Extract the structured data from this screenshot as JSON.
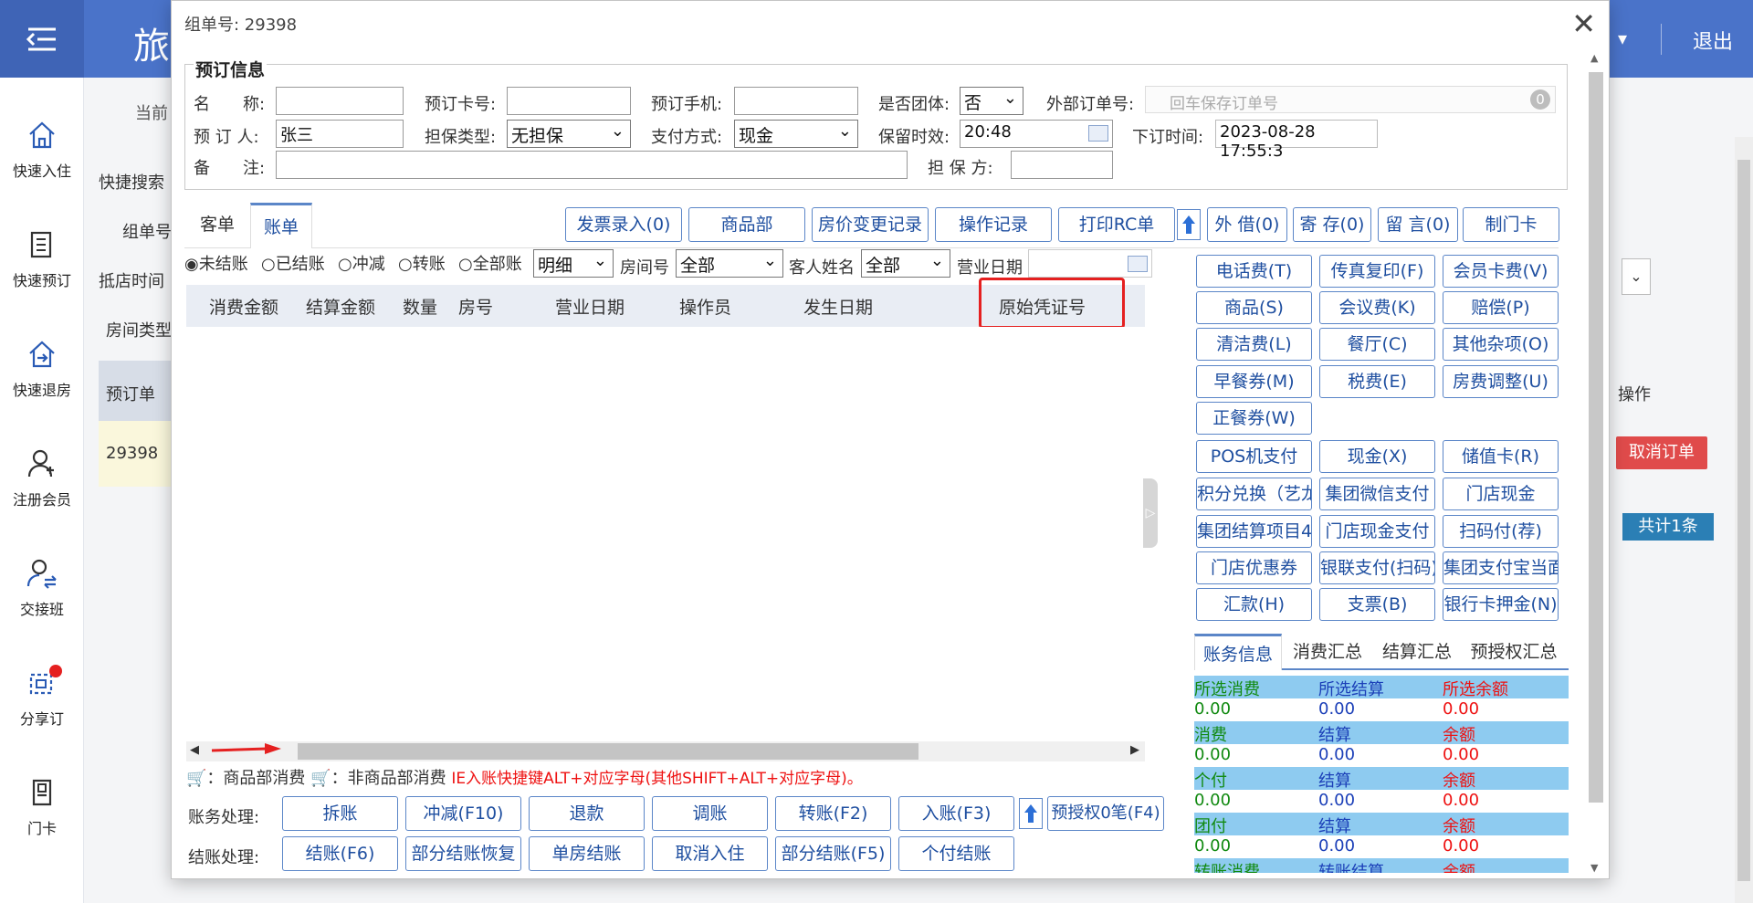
{
  "app": {
    "title_fragment": "旅",
    "logout": "退出",
    "sidebar": [
      "快速入住",
      "快速预订",
      "快速退房",
      "注册会员",
      "交接班",
      "分享订",
      "门卡"
    ]
  },
  "background": {
    "current_fragment": "当前",
    "quick_search": "快捷搜索",
    "group_no_label": "组单号",
    "arrival_label": "抵店时间",
    "room_type_label": "房间类型",
    "col_order": "预订单",
    "col_action_fragment": "操作",
    "row_order": "29398",
    "cancel_button": "取消订单",
    "total": "共计1条"
  },
  "modal": {
    "title": "组单号: 29398",
    "close": "✕",
    "booking": {
      "legend": "预订信息",
      "name_label": "名　　称:",
      "name_value": "",
      "card_label": "预订卡号:",
      "card_value": "",
      "phone_label": "预订手机:",
      "phone_value": "",
      "group_label": "是否团体:",
      "group_value": "否",
      "ext_order_label": "外部订单号:",
      "ext_order_placeholder": "回车保存订单号",
      "ext_order_badge": "0",
      "booker_label": "预 订 人:",
      "booker_value": "张三",
      "guarantee_type_label": "担保类型:",
      "guarantee_type_value": "无担保",
      "payment_label": "支付方式:",
      "payment_value": "现金",
      "hold_label": "保留时效:",
      "hold_value": "20:48",
      "order_time_label": "下订时间:",
      "order_time_value": "2023-08-28 17:55:3",
      "remark_label": "备　　注:",
      "remark_value": "",
      "guarantor_label": "担 保 方:",
      "guarantor_value": ""
    },
    "tabs": [
      "客单",
      "账单"
    ],
    "toolbar": [
      "发票录入(0)",
      "商品部",
      "房价变更记录",
      "操作记录",
      "打印RC单",
      "外 借(0)",
      "寄 存(0)",
      "留 言(0)",
      "制门卡"
    ],
    "filters": {
      "radios": [
        "未结账",
        "已结账",
        "冲减",
        "转账",
        "全部账"
      ],
      "detail_value": "明细",
      "room_label": "房间号",
      "room_value": "全部",
      "guest_label": "客人姓名",
      "guest_value": "全部",
      "bizdate_label": "营业日期"
    },
    "grid_columns": [
      "消费金额",
      "结算金额",
      "数量",
      "房号",
      "营业日期",
      "操作员",
      "发生日期",
      "原始凭证号"
    ],
    "charge_buttons": [
      "电话费(T)",
      "传真复印(F)",
      "会员卡费(V)",
      "商品(S)",
      "会议费(K)",
      "赔偿(P)",
      "清洁费(L)",
      "餐厅(C)",
      "其他杂项(O)",
      "早餐券(M)",
      "税费(E)",
      "房费调整(U)",
      "正餐券(W)"
    ],
    "payment_buttons": [
      "POS机支付",
      "现金(X)",
      "储值卡(R)",
      "积分兑换（艺龙）",
      "集团微信支付",
      "门店现金",
      "集团结算项目4",
      "门店现金支付",
      "扫码付(荐)",
      "门店优惠券",
      "银联支付(扫码)",
      "集团支付宝当面付",
      "汇款(H)",
      "支票(B)",
      "银行卡押金(N)"
    ],
    "help": {
      "goods": "：商品部消费",
      "non_goods": "：非商品部消费",
      "hint": "IE入账快捷键ALT+对应字母(其他SHIFT+ALT+对应字母)。"
    },
    "account_label": "账务处理:",
    "account_buttons": [
      "拆账",
      "冲减(F10)",
      "退款",
      "调账",
      "转账(F2)",
      "入账(F3)",
      "预授权0笔(F4)"
    ],
    "checkout_label": "结账处理:",
    "checkout_buttons": [
      "结账(F6)",
      "部分结账恢复",
      "单房结账",
      "取消入住",
      "部分结账(F5)",
      "个付结账"
    ],
    "summary_tabs": [
      "账务信息",
      "消费汇总",
      "结算汇总",
      "预授权汇总"
    ],
    "summary_rows": [
      {
        "a": "所选消费",
        "b": "所选结算",
        "c": "所选余额",
        "header": true
      },
      {
        "a": "0.00",
        "b": "0.00",
        "c": "0.00",
        "header": false
      },
      {
        "a": "消费",
        "b": "结算",
        "c": "余额",
        "header": true
      },
      {
        "a": "0.00",
        "b": "0.00",
        "c": "0.00",
        "header": false
      },
      {
        "a": "个付",
        "b": "结算",
        "c": "余额",
        "header": true
      },
      {
        "a": "0.00",
        "b": "0.00",
        "c": "0.00",
        "header": false
      },
      {
        "a": "团付",
        "b": "结算",
        "c": "余额",
        "header": true
      },
      {
        "a": "0.00",
        "b": "0.00",
        "c": "0.00",
        "header": false
      },
      {
        "a": "转账消费",
        "b": "转账结算",
        "c": "余额",
        "header": true
      }
    ]
  }
}
